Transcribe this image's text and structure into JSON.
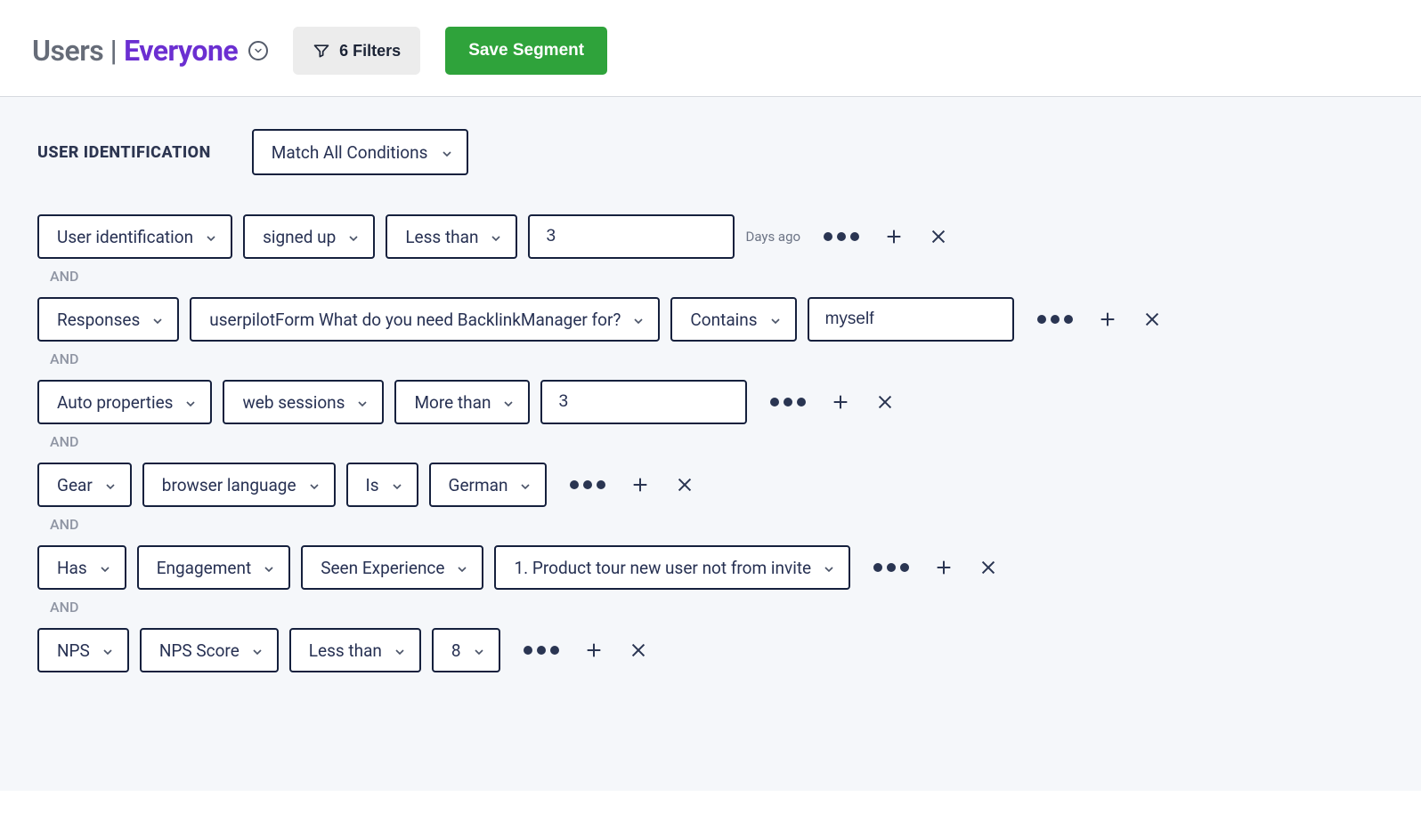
{
  "header": {
    "title_prefix": "Users |",
    "segment_name": "Everyone",
    "filters_label": "6 Filters",
    "save_label": "Save Segment"
  },
  "section": {
    "title": "USER IDENTIFICATION",
    "match_mode": "Match All Conditions",
    "and_label": "AND"
  },
  "rows": [
    {
      "s0": "User identification",
      "s1": "signed up",
      "s2": "Less than",
      "input": "3",
      "suffix": "Days ago"
    },
    {
      "s0": "Responses",
      "s1": "userpilotForm What do you need BacklinkManager for?",
      "s2": "Contains",
      "input": "myself"
    },
    {
      "s0": "Auto properties",
      "s1": "web sessions",
      "s2": "More than",
      "input": "3"
    },
    {
      "s0": "Gear",
      "s1": "browser language",
      "s2": "Is",
      "s3": "German"
    },
    {
      "s0": "Has",
      "s1": "Engagement",
      "s2": "Seen Experience",
      "s3": "1. Product tour new user not from invite"
    },
    {
      "s0": "NPS",
      "s1": "NPS Score",
      "s2": "Less than",
      "s3": "8"
    }
  ]
}
